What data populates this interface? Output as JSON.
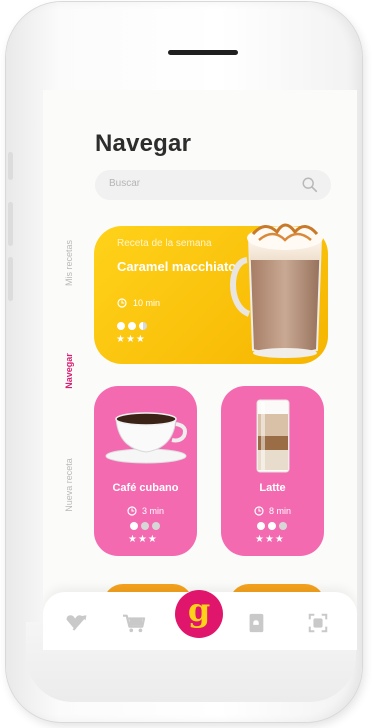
{
  "screen": {
    "title": "Navegar",
    "search": {
      "placeholder": "Buscar"
    }
  },
  "side_tabs": [
    {
      "label": "Mis recetas",
      "active": false
    },
    {
      "label": "Navegar",
      "active": true
    },
    {
      "label": "Nueva receta",
      "active": false
    }
  ],
  "featured": {
    "subtitle": "Receta de la semana",
    "name": "Caramel macchiato",
    "time": "10 min",
    "difficulty": 2.5,
    "rating": "★★★",
    "image_icon": "caramel-macchiato-glass"
  },
  "recipes": [
    {
      "name": "Café cubano",
      "time": "3 min",
      "difficulty": 1,
      "rating": "★★★",
      "image_icon": "coffee-cup"
    },
    {
      "name": "Latte",
      "time": "8 min",
      "difficulty": 2,
      "rating": "★★★",
      "image_icon": "latte-glass"
    }
  ],
  "tabbar": {
    "items": [
      "heart-arrow-icon",
      "cart-icon",
      "g-logo-button",
      "recipe-book-icon",
      "scan-icon"
    ],
    "logo_letter": "g"
  },
  "colors": {
    "brand_pink": "#e0166c",
    "yellow": "#ffd21a",
    "card_pink": "#f36ab1",
    "orange": "#f5a21d"
  }
}
